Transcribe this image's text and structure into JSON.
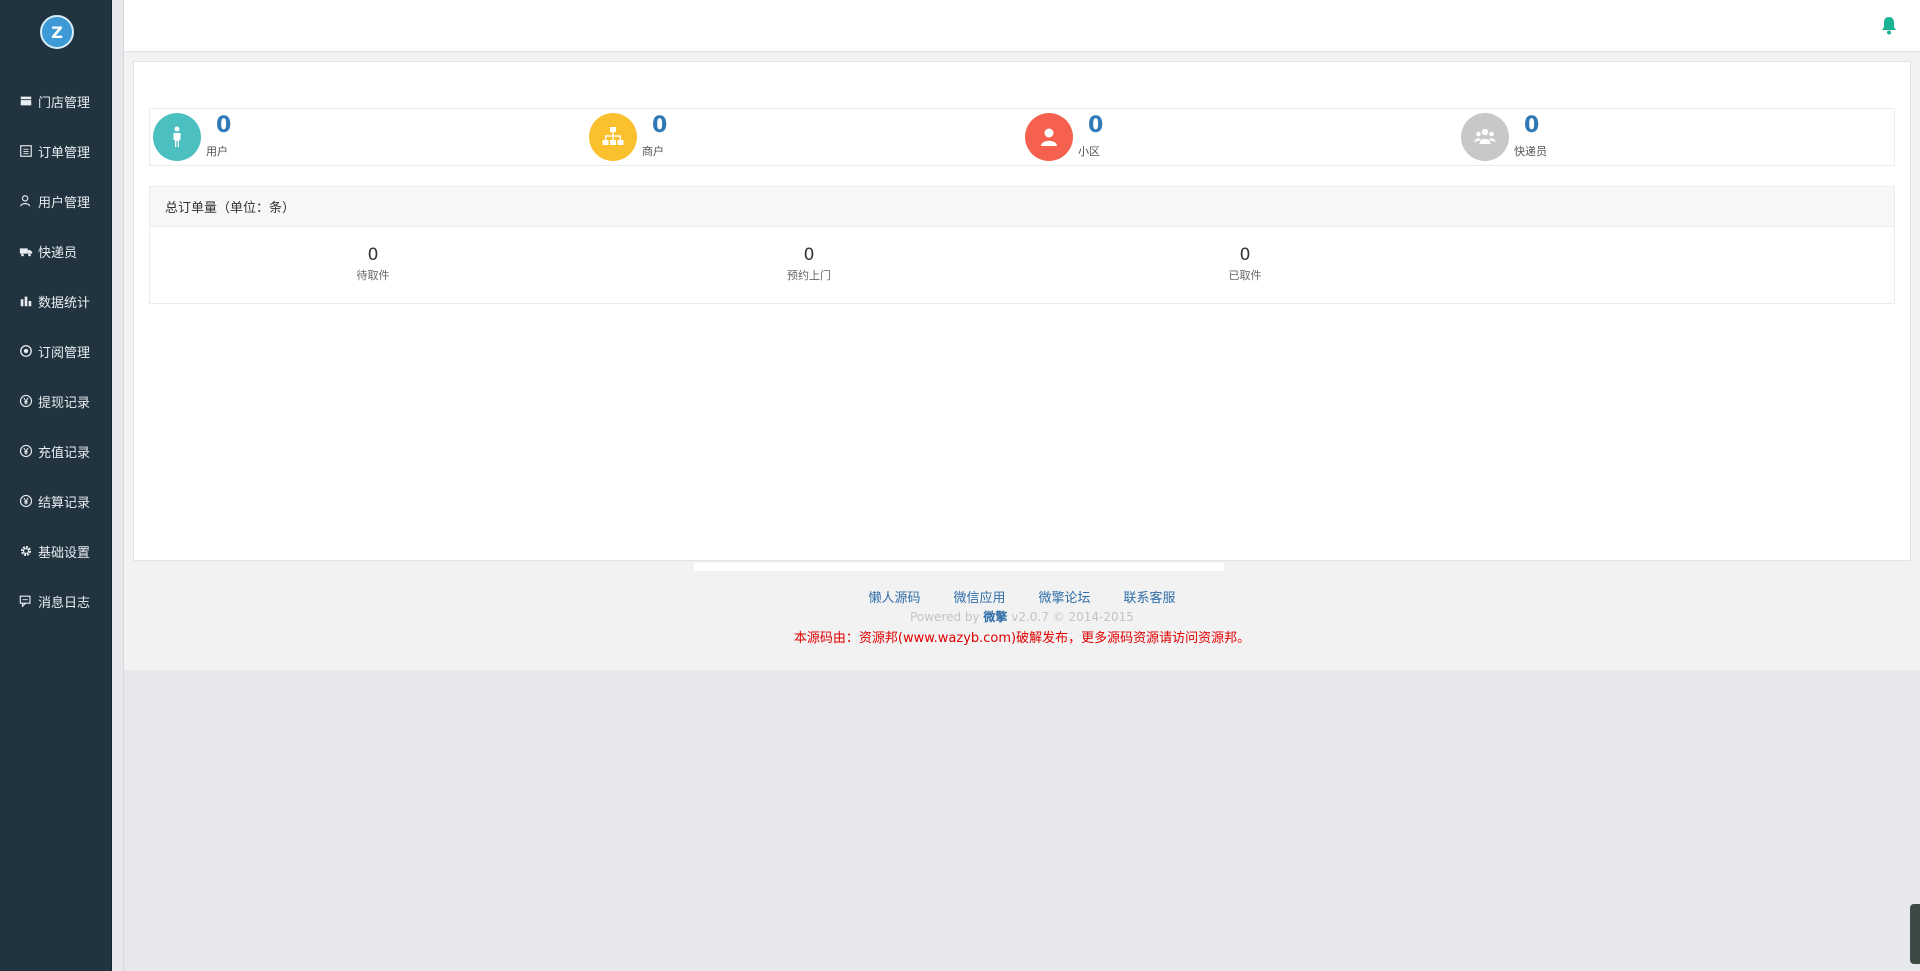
{
  "sidebar": {
    "logo_text": "Z",
    "items": [
      {
        "label": "门店管理",
        "icon": "store-icon"
      },
      {
        "label": "订单管理",
        "icon": "list-icon"
      },
      {
        "label": "用户管理",
        "icon": "user-icon"
      },
      {
        "label": "快递员",
        "icon": "truck-icon"
      },
      {
        "label": "数据统计",
        "icon": "bar-chart-icon"
      },
      {
        "label": "订阅管理",
        "icon": "subscribe-icon"
      },
      {
        "label": "提现记录",
        "icon": "yen-icon"
      },
      {
        "label": "充值记录",
        "icon": "yen-icon"
      },
      {
        "label": "结算记录",
        "icon": "yen-icon"
      },
      {
        "label": "基础设置",
        "icon": "gear-icon"
      },
      {
        "label": "消息日志",
        "icon": "message-icon"
      }
    ]
  },
  "colors": {
    "sidebar_bg": "#20333f",
    "accent_blue": "#2f79b7",
    "teal": "#4cc0c0",
    "yellow": "#fbc02d",
    "red": "#f5614e",
    "gray": "#c8c8c8",
    "bell": "#1ab394",
    "notice_red": "#e00000"
  },
  "stats": [
    {
      "value": "0",
      "label": "用户",
      "icon": "person-icon",
      "color": "#4cc0c0"
    },
    {
      "value": "0",
      "label": "商户",
      "icon": "sitemap-icon",
      "color": "#fbc02d"
    },
    {
      "value": "0",
      "label": "小区",
      "icon": "user-circle-icon",
      "color": "#f5614e"
    },
    {
      "value": "0",
      "label": "快递员",
      "icon": "group-icon",
      "color": "#c8c8c8"
    }
  ],
  "orders": {
    "title": "总订单量（单位：条）",
    "cells": [
      {
        "value": "0",
        "label": "待取件"
      },
      {
        "value": "0",
        "label": "预约上门"
      },
      {
        "value": "0",
        "label": "已取件"
      }
    ]
  },
  "footer": {
    "links": [
      "懒人源码",
      "微信应用",
      "微擎论坛",
      "联系客服"
    ],
    "powered_prefix": "Powered by ",
    "powered_brand": "微擎",
    "powered_suffix": " v2.0.7 © 2014-2015",
    "notice": "本源码由：资源邦(www.wazyb.com)破解发布，更多源码资源请访问资源邦。"
  }
}
